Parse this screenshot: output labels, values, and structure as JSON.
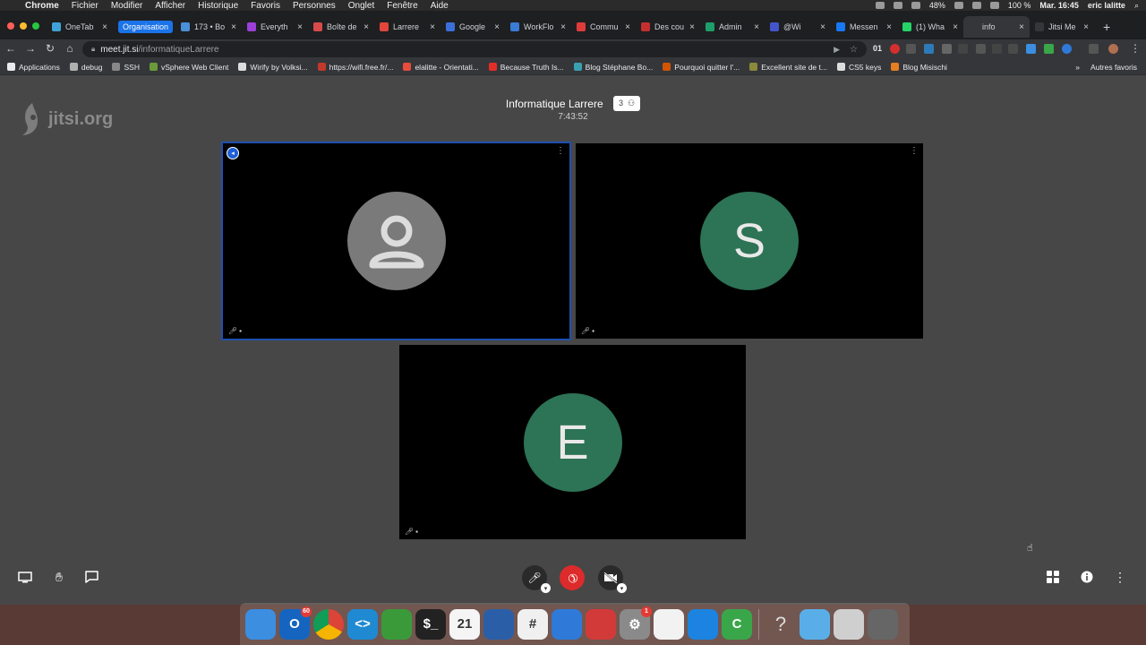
{
  "menubar": {
    "app": "Chrome",
    "menus": [
      "Fichier",
      "Modifier",
      "Afficher",
      "Historique",
      "Favoris",
      "Personnes",
      "Onglet",
      "Fenêtre",
      "Aide"
    ],
    "battery": "48%",
    "wifi_battery": "100 %",
    "clock": "Mar. 16:45",
    "user": "eric lalitte"
  },
  "tabs": [
    {
      "title": "OneTab",
      "color": "#3fa3d8"
    },
    {
      "title": "Organisation",
      "color": "#1a73e8",
      "group": true
    },
    {
      "title": "173 • Bo",
      "color": "#4a8fd8"
    },
    {
      "title": "Everyth",
      "color": "#9c3fd8"
    },
    {
      "title": "Boîte de",
      "color": "#d84a4a"
    },
    {
      "title": "Larrere",
      "color": "#e0463c"
    },
    {
      "title": "Google",
      "color": "#3b6fd8"
    },
    {
      "title": "WorkFlo",
      "color": "#3a7bd5"
    },
    {
      "title": "Commu",
      "color": "#e03b3b"
    },
    {
      "title": "Des cou",
      "color": "#c43030"
    },
    {
      "title": "Admin",
      "color": "#1e9e6a"
    },
    {
      "title": "@Wi",
      "color": "#4455cc"
    },
    {
      "title": "Messen",
      "color": "#1877f2"
    },
    {
      "title": "(1) Wha",
      "color": "#25d366"
    },
    {
      "title": "info",
      "color": "#35363a",
      "active": true
    },
    {
      "title": "Jitsi Me",
      "color": "#35363a"
    }
  ],
  "address": {
    "host": "meet.jit.si",
    "path": "/informatiqueLarrere",
    "profile_badge": "01"
  },
  "bookmarks": [
    {
      "label": "Applications",
      "color": "#e8eaed"
    },
    {
      "label": "debug",
      "color": "#b0b0b0"
    },
    {
      "label": "SSH",
      "color": "#888"
    },
    {
      "label": "vSphere Web Client",
      "color": "#6a9a3a"
    },
    {
      "label": "Wirify by Volksi...",
      "color": "#ddd"
    },
    {
      "label": "https://wifi.free.fr/...",
      "color": "#c0392b"
    },
    {
      "label": "elalitte - Orientati...",
      "color": "#e74c3c"
    },
    {
      "label": "Because Truth Is...",
      "color": "#e52d27"
    },
    {
      "label": "Blog Stéphane Bo...",
      "color": "#3aa0b0"
    },
    {
      "label": "Pourquoi quitter l'...",
      "color": "#d35400"
    },
    {
      "label": "Excellent site de t...",
      "color": "#8a8a3a"
    },
    {
      "label": "CS5 keys",
      "color": "#ddd"
    },
    {
      "label": "Blog Misischi",
      "color": "#e67e22"
    }
  ],
  "bookmarks_other": "Autres favoris",
  "conference": {
    "logo_text": "jitsi.org",
    "title": "Informatique Larrere",
    "participant_count": "3",
    "timer": "7:43:52"
  },
  "participants": [
    {
      "initial": "",
      "avatar_color": "#7a7a7a",
      "active": true
    },
    {
      "initial": "S",
      "avatar_color": "#2d7356"
    },
    {
      "initial": "E",
      "avatar_color": "#2d7356"
    }
  ],
  "toolbar_icons": [
    "screen-share",
    "raise-hand",
    "chat",
    "microphone",
    "hangup",
    "camera",
    "tile-view",
    "info",
    "more"
  ],
  "dock": [
    {
      "name": "finder",
      "color": "#3b8ee0",
      "glyph": ""
    },
    {
      "name": "outlook",
      "color": "#1565c0",
      "glyph": "O",
      "badge": "60"
    },
    {
      "name": "chrome",
      "color": "#e0e0e0",
      "glyph": ""
    },
    {
      "name": "vscode",
      "color": "#1f8ad2",
      "glyph": "<>"
    },
    {
      "name": "mongodb",
      "color": "#3a9a3a",
      "glyph": ""
    },
    {
      "name": "terminal",
      "color": "#222",
      "glyph": "$_"
    },
    {
      "name": "calendar",
      "color": "#f5f5f5",
      "glyph": "21"
    },
    {
      "name": "virtualbox",
      "color": "#2a5fa8",
      "glyph": ""
    },
    {
      "name": "slack",
      "color": "#f0f0f0",
      "glyph": "#"
    },
    {
      "name": "keynote",
      "color": "#2f7ad8",
      "glyph": ""
    },
    {
      "name": "remote-desktop",
      "color": "#d23a3a",
      "glyph": ""
    },
    {
      "name": "system-preferences",
      "color": "#8a8a8a",
      "glyph": "⚙",
      "badge": "1"
    },
    {
      "name": "textedit",
      "color": "#f2f2f2",
      "glyph": ""
    },
    {
      "name": "teamviewer",
      "color": "#1c84e0",
      "glyph": ""
    },
    {
      "name": "camtasia",
      "color": "#3aa64a",
      "glyph": "C"
    },
    {
      "name": "help",
      "color": "transparent",
      "glyph": "?"
    },
    {
      "name": "folder",
      "color": "#5aaee8",
      "glyph": ""
    },
    {
      "name": "downloads",
      "color": "#cfcfcf",
      "glyph": ""
    },
    {
      "name": "trash",
      "color": "#666",
      "glyph": ""
    }
  ]
}
